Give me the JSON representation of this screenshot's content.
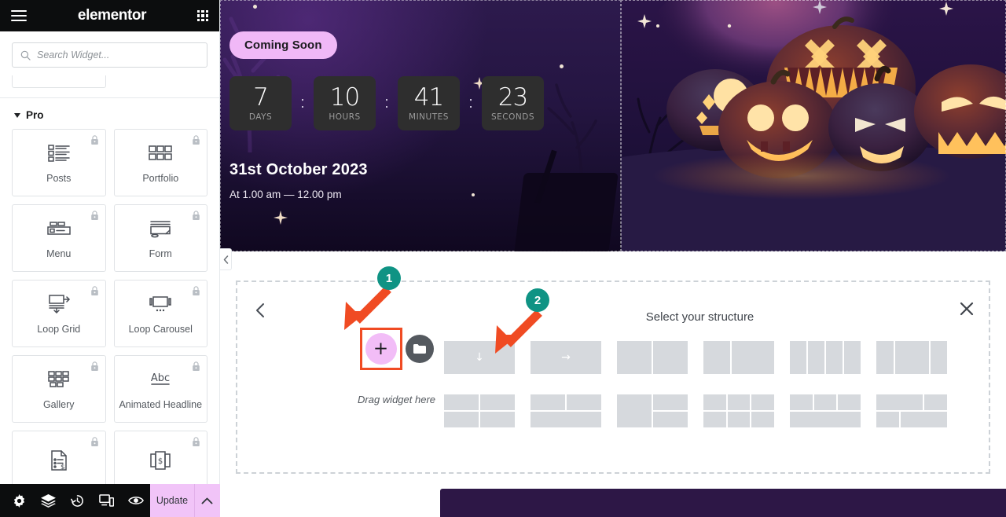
{
  "panel": {
    "brand": "elementor",
    "menu_icon": "hamburger-icon",
    "apps_icon": "grid-apps-icon",
    "search": {
      "placeholder": "Search Widget...",
      "value": "",
      "icon": "search-icon"
    },
    "category": {
      "label": "Pro",
      "caret_icon": "caret-down-icon",
      "expanded": true
    },
    "widgets": [
      {
        "label": "Posts",
        "icon": "posts-icon",
        "locked": true
      },
      {
        "label": "Portfolio",
        "icon": "portfolio-grid-icon",
        "locked": true
      },
      {
        "label": "Menu",
        "icon": "nav-menu-icon",
        "locked": true
      },
      {
        "label": "Form",
        "icon": "form-icon",
        "locked": true
      },
      {
        "label": "Loop Grid",
        "icon": "loop-grid-icon",
        "locked": true
      },
      {
        "label": "Loop Carousel",
        "icon": "loop-carousel-icon",
        "locked": true
      },
      {
        "label": "Gallery",
        "icon": "gallery-icon",
        "locked": true
      },
      {
        "label": "Animated Headline",
        "icon": "animated-headline-icon",
        "locked": true
      },
      {
        "label": "",
        "icon": "price-list-icon",
        "locked": true
      },
      {
        "label": "",
        "icon": "price-table-icon",
        "locked": true
      }
    ],
    "lock_icon": "lock-icon",
    "collapse_icon": "chevron-left-icon"
  },
  "bottom_bar": {
    "tools": [
      {
        "name": "settings",
        "icon": "gear-icon"
      },
      {
        "name": "navigator",
        "icon": "layers-icon"
      },
      {
        "name": "history",
        "icon": "history-clock-icon"
      },
      {
        "name": "responsive",
        "icon": "responsive-devices-icon"
      },
      {
        "name": "preview",
        "icon": "eye-icon"
      }
    ],
    "update_label": "Update",
    "update_caret_icon": "chevron-up-icon",
    "update_color": "#f1c4f8"
  },
  "canvas": {
    "hero": {
      "badge": "Coming Soon",
      "countdown": {
        "separator": ":",
        "units": [
          {
            "value": "7",
            "label": "DAYS"
          },
          {
            "value": "10",
            "label": "HOURS"
          },
          {
            "value": "41",
            "label": "MINUTES"
          },
          {
            "value": "23",
            "label": "SECONDS"
          }
        ]
      },
      "date": "31st October 2023",
      "time": "At 1.00 am — 12.00 pm",
      "image_alt": "halloween-jack-o-lanterns-photo"
    },
    "add_section": {
      "back_icon": "chevron-left-icon",
      "close_icon": "close-x-icon",
      "plus_icon": "plus-icon",
      "folder_icon": "folder-icon",
      "drag_text": "Drag widget here",
      "structure_title": "Select your structure",
      "structures": [
        {
          "name": "container-column",
          "layout": "arrow-down",
          "arrow": "↓"
        },
        {
          "name": "container-row",
          "layout": "arrow-right",
          "arrow": "→"
        },
        {
          "name": "two-equal",
          "layout": "cols:1,1"
        },
        {
          "name": "two-wide-left",
          "layout": "cols:1,1.6"
        },
        {
          "name": "four-equal",
          "layout": "cols:1,1,1,1"
        },
        {
          "name": "three-wide-middle",
          "layout": "cols:1,2,1"
        },
        {
          "name": "grid-2x2",
          "layout": "grid:2x2"
        },
        {
          "name": "two-top-one-bottom",
          "layout": "rows:2,1"
        },
        {
          "name": "left-full-right-split",
          "layout": "left-split"
        },
        {
          "name": "grid-3x2",
          "layout": "grid:3x2"
        },
        {
          "name": "three-top-one-bottom",
          "layout": "rows:3,1"
        },
        {
          "name": "mixed-two-two",
          "layout": "mixed"
        }
      ]
    },
    "annotations": [
      {
        "number": "1",
        "target": "add-new-element-plus-button",
        "color": "#0f9384"
      },
      {
        "number": "2",
        "target": "structure-option-container-column",
        "color": "#0f9384"
      }
    ]
  }
}
